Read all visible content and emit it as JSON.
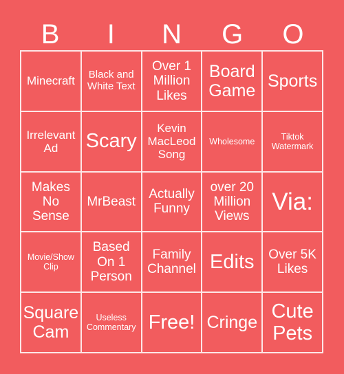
{
  "header": {
    "letters": [
      "B",
      "I",
      "N",
      "G",
      "O"
    ]
  },
  "theme": {
    "background": "#F25C5E",
    "text": "#FFFFFF"
  },
  "cells": [
    "Minecraft",
    "Black and White Text",
    "Over 1 Million Likes",
    "Board Game",
    "Sports",
    "Irrelevant Ad",
    "Scary",
    "Kevin MacLeod Song",
    "Wholesome",
    "Tiktok Watermark",
    "Makes No Sense",
    "MrBeast",
    "Actually Funny",
    "over 20 Million Views",
    "Via:",
    "Movie/Show Clip",
    "Based On 1 Person",
    "Family Channel",
    "Edits",
    "Over 5K Likes",
    "Square Cam",
    "Useless Commentary",
    "Free!",
    "Cringe",
    "Cute Pets"
  ]
}
